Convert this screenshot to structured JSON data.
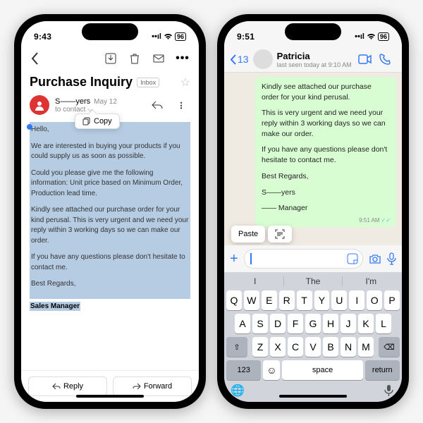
{
  "left": {
    "status": {
      "time": "9:43",
      "battery": "96"
    },
    "subject": "Purchase Inquiry",
    "inbox_chip": "Inbox",
    "sender": "S——yers",
    "date": "May 12",
    "to": "to contact",
    "copy_label": "Copy",
    "body": {
      "p1": "Hello,",
      "p2": "We are interested in buying your products if you could supply us as soon as possible.",
      "p3": "Could you please give me the following information: Unit price based on Minimum Order, Production lead time.",
      "p4": "Kindly see attached our purchase order for your kind perusal. This is very urgent and we need your reply within 3 working days so we can make our order.",
      "p5": "If you have any questions please don't hesitate to contact me.",
      "p6": "Best Regards,",
      "sig": "Sales Manager"
    },
    "reply": "Reply",
    "forward": "Forward"
  },
  "right": {
    "status": {
      "time": "9:51",
      "battery": "96"
    },
    "back_count": "13",
    "contact": "Patricia",
    "last_seen": "last seen today at 9:10 AM",
    "bubble": {
      "p1": "Kindly see attached our purchase order for your kind perusal.",
      "p2": "This is very urgent and we need your reply within 3 working days so we can make our order.",
      "p3": "If you have any questions please don't hesitate to contact me.",
      "p4": "Best Regards,",
      "p5": "S——yers",
      "p6": "—— Manager",
      "time": "9:51 AM"
    },
    "paste": "Paste",
    "sugg": {
      "s1": "I",
      "s2": "The",
      "s3": "I'm"
    },
    "keys_r1": [
      "Q",
      "W",
      "E",
      "R",
      "T",
      "Y",
      "U",
      "I",
      "O",
      "P"
    ],
    "keys_r2": [
      "A",
      "S",
      "D",
      "F",
      "G",
      "H",
      "J",
      "K",
      "L"
    ],
    "keys_r3": [
      "Z",
      "X",
      "C",
      "V",
      "B",
      "N",
      "M"
    ],
    "k123": "123",
    "space": "space",
    "return": "return"
  }
}
